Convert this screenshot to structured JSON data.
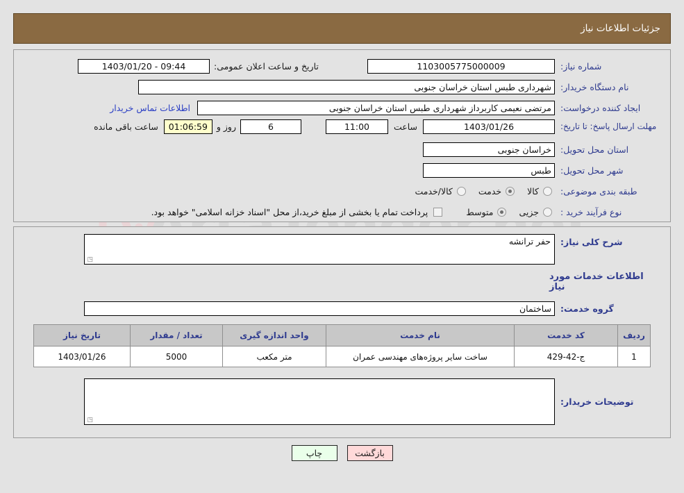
{
  "header": {
    "title": "جزئیات اطلاعات نیاز"
  },
  "watermark": {
    "text": "ArtaTender.net",
    "shield_color": "#f0c8cc"
  },
  "need_info": {
    "need_number_label": "شماره نیاز:",
    "need_number_value": "1103005775000009",
    "announce_label": "تاریخ و ساعت اعلان عمومی:",
    "announce_value": "09:44 - 1403/01/20",
    "buyer_org_label": "نام دستگاه خریدار:",
    "buyer_org_value": "شهرداری طبس استان خراسان جنوبی",
    "creator_label": "ایجاد کننده درخواست:",
    "creator_value": "مرتضی نعیمی کاربرداز شهرداری طبس استان خراسان جنوبی",
    "contact_link": "اطلاعات تماس خریدار",
    "deadline_label": "مهلت ارسال پاسخ: تا تاریخ:",
    "deadline_date": "1403/01/26",
    "time_label": "ساعت",
    "time_value": "11:00",
    "days_value": "6",
    "days_label": "روز و",
    "countdown_value": "01:06:59",
    "countdown_label": "ساعت باقی مانده",
    "province_label": "استان محل تحویل:",
    "province_value": "خراسان جنوبی",
    "city_label": "شهر محل تحویل:",
    "city_value": "طبس",
    "category_label": "طبقه بندی موضوعی:",
    "category_options": [
      {
        "label": "کالا",
        "selected": false
      },
      {
        "label": "خدمت",
        "selected": true
      },
      {
        "label": "کالا/خدمت",
        "selected": false
      }
    ],
    "process_label": "نوع فرآیند خرید :",
    "process_options": [
      {
        "label": "جزیی",
        "selected": false
      },
      {
        "label": "متوسط",
        "selected": true
      }
    ],
    "treasury_checked": false,
    "treasury_note": "پرداخت تمام یا بخشی از مبلغ خرید،از محل \"اسناد خزانه اسلامی\" خواهد بود."
  },
  "details": {
    "general_desc_label": "شرح کلی نیاز:",
    "general_desc_value": "حفر ترانشه",
    "services_heading": "اطلاعات خدمات مورد نیاز",
    "service_group_label": "گروه خدمت:",
    "service_group_value": "ساختمان",
    "buyer_notes_label": "توضیحات خریدار:",
    "buyer_notes_value": ""
  },
  "table": {
    "columns": [
      "ردیف",
      "کد خدمت",
      "نام خدمت",
      "واحد اندازه گیری",
      "تعداد / مقدار",
      "تاریخ نیاز"
    ],
    "rows": [
      {
        "index": "1",
        "service_code": "ج-42-429",
        "service_name": "ساخت سایر پروژه‌های مهندسی عمران",
        "unit": "متر مکعب",
        "quantity": "5000",
        "need_date": "1403/01/26"
      }
    ]
  },
  "footer": {
    "print_label": "چاپ",
    "back_label": "بازگشت"
  }
}
